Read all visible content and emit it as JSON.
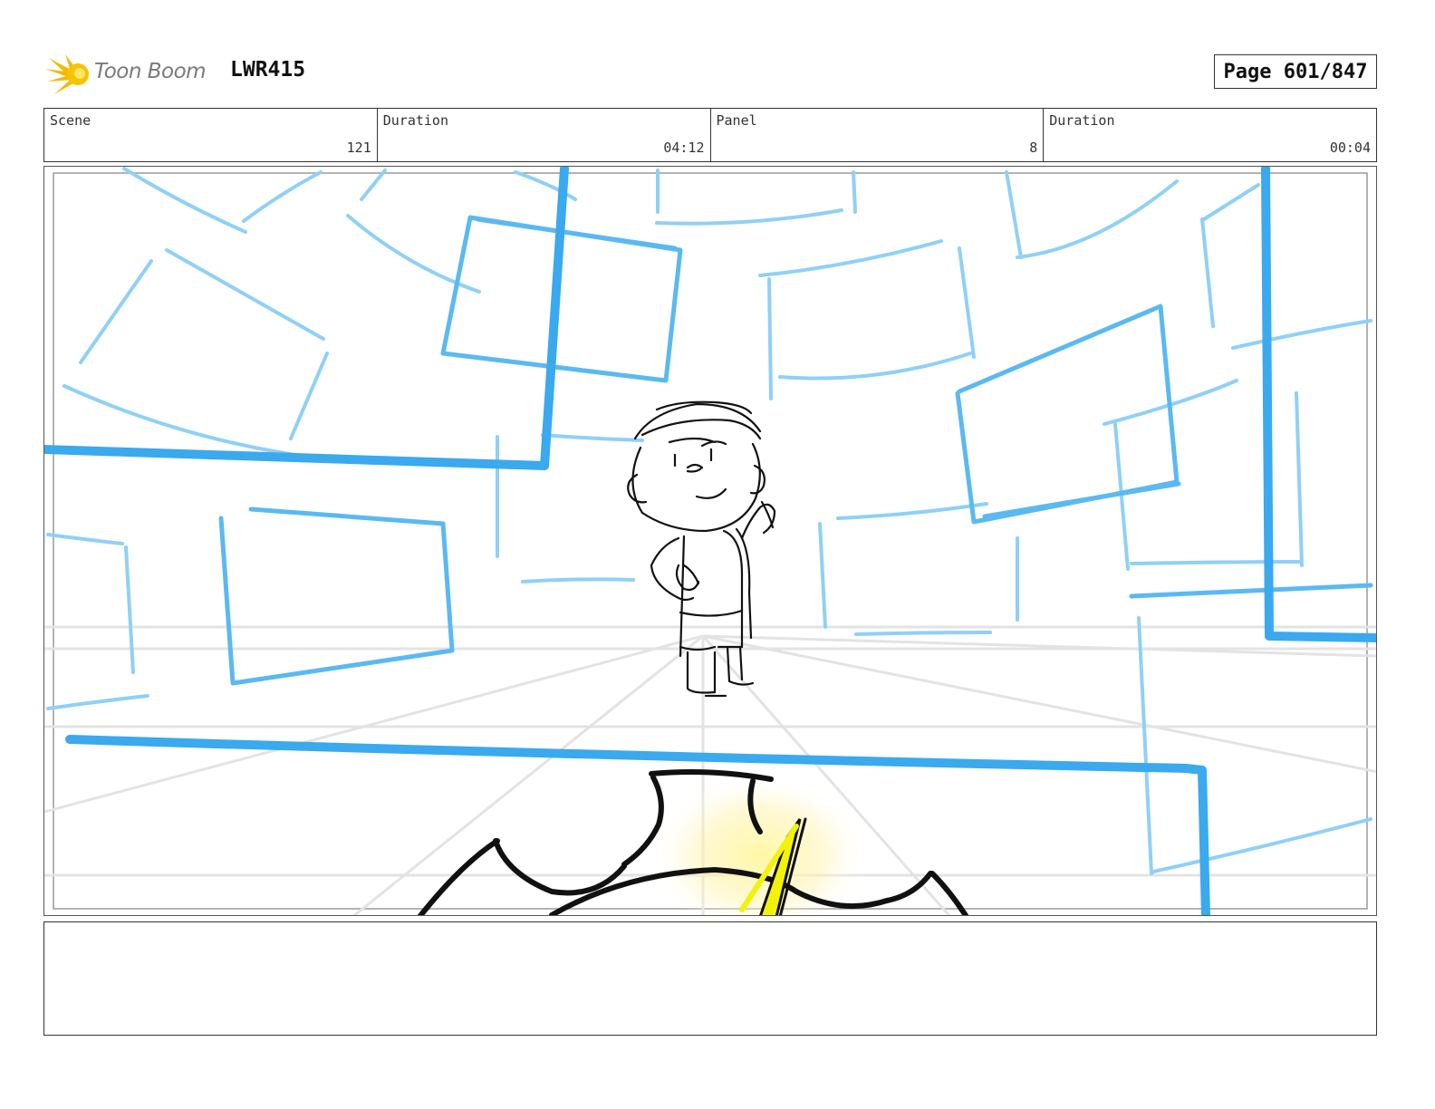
{
  "header": {
    "brand": "Toon Boom",
    "project_code": "LWR415",
    "page_label": "Page 601/847"
  },
  "info_bar": {
    "scene_label": "Scene",
    "scene_value": "121",
    "scene_duration_label": "Duration",
    "scene_duration_value": "04:12",
    "panel_label": "Panel",
    "panel_value": "8",
    "panel_duration_label": "Duration",
    "panel_duration_value": "00:04"
  },
  "notes": {
    "text": ""
  },
  "colors": {
    "layout_blue": "#3aa9ee",
    "layout_light_blue": "#8fd0f7",
    "ink": "#111111",
    "glow_yellow": "#f2f20a"
  }
}
